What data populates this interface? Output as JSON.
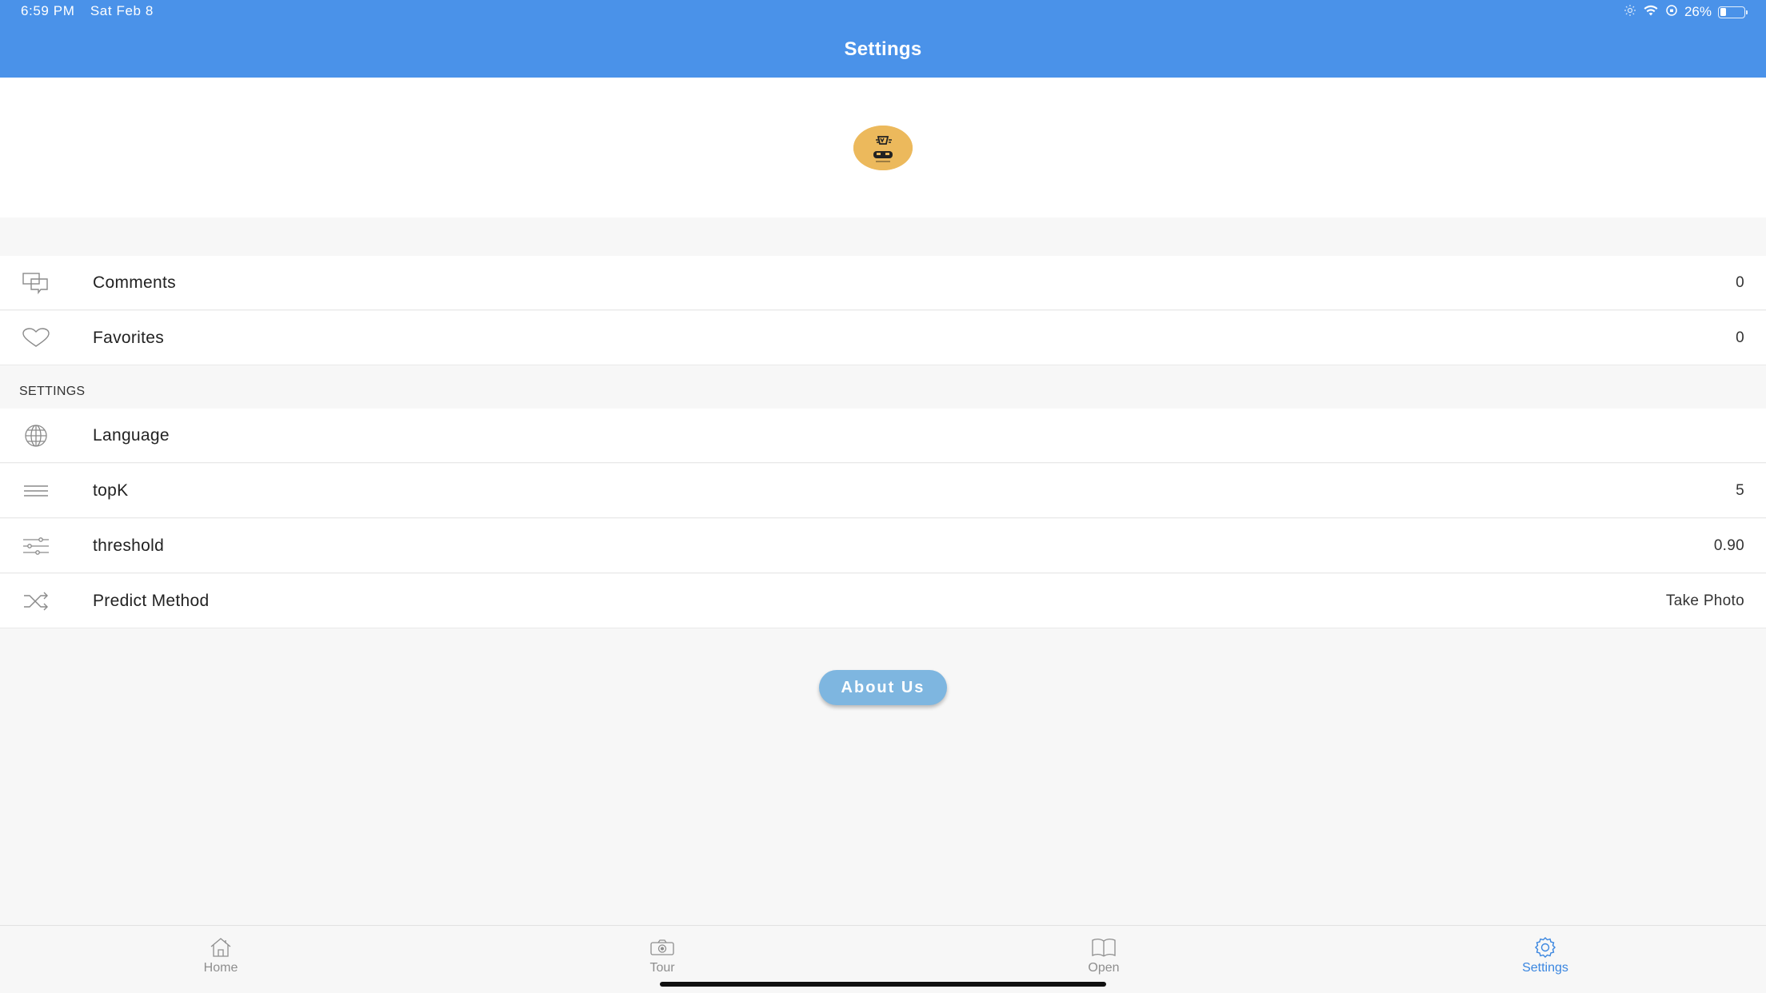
{
  "status_bar": {
    "time": "6:59 PM",
    "date": "Sat Feb 8",
    "battery_text": "26%",
    "battery_level": 0.26
  },
  "nav": {
    "title": "Settings"
  },
  "colors": {
    "nav_bar": "#4a92e9",
    "accent": "#3a86e0",
    "button": "#7eb6e0",
    "avatar": "#ecb95c"
  },
  "stats": [
    {
      "icon": "comments-icon",
      "label": "Comments",
      "value": "0"
    },
    {
      "icon": "heart-icon",
      "label": "Favorites",
      "value": "0"
    }
  ],
  "settings": {
    "section_title": "SETTINGS",
    "rows": [
      {
        "icon": "globe-icon",
        "label": "Language",
        "value": ""
      },
      {
        "icon": "lines-icon",
        "label": "topK",
        "value": "5"
      },
      {
        "icon": "sliders-icon",
        "label": "threshold",
        "value": "0.90"
      },
      {
        "icon": "shuffle-icon",
        "label": "Predict Method",
        "value": "Take Photo"
      }
    ]
  },
  "about_button": "About Us",
  "tabs": [
    {
      "icon": "home-icon",
      "label": "Home",
      "active": false
    },
    {
      "icon": "camera-icon",
      "label": "Tour",
      "active": false
    },
    {
      "icon": "book-icon",
      "label": "Open",
      "active": false
    },
    {
      "icon": "gear-icon",
      "label": "Settings",
      "active": true
    }
  ]
}
